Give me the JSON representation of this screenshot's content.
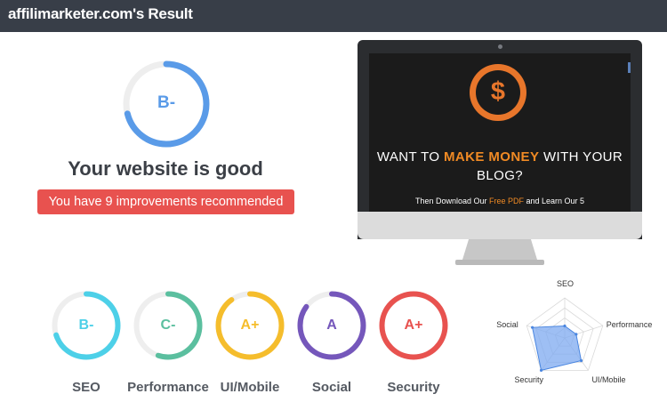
{
  "header": {
    "title": "affilimarketer.com's Result"
  },
  "summary": {
    "grade": "B-",
    "score": 0.71,
    "ring_color": "#5a9be8",
    "headline": "Your website is good",
    "improvements": "You have 9 improvements recommended",
    "improvements_color": "#e8524f"
  },
  "preview": {
    "headline_pre": "WANT TO ",
    "headline_accent": "MAKE MONEY",
    "headline_post": " WITH YOUR BLOG?",
    "sub_pre": "Then Download Our ",
    "sub_accent": "Free PDF",
    "sub_post": " and Learn Our 5",
    "logo_glyph": "$",
    "logo_icon": "dollar-coin-icon",
    "accent_color": "#f08a24"
  },
  "metrics": [
    {
      "label": "SEO",
      "grade": "B-",
      "color": "#4dd0e8",
      "score": 0.7
    },
    {
      "label": "Performance",
      "grade": "C-",
      "color": "#5bbf9f",
      "score": 0.55
    },
    {
      "label": "UI/Mobile",
      "grade": "A+",
      "color": "#f5bd2c",
      "score": 0.9
    },
    {
      "label": "Social",
      "grade": "A",
      "color": "#7557bb",
      "score": 0.85
    },
    {
      "label": "Security",
      "grade": "A+",
      "color": "#e8524f",
      "score": 1.0
    }
  ],
  "radar": {
    "axes": [
      "SEO",
      "Performance",
      "UI/Mobile",
      "Security",
      "Social"
    ],
    "values": [
      0.3,
      0.3,
      0.7,
      1.0,
      0.85
    ],
    "fill_color": "#7eaaf0",
    "stroke_color": "#4a86e0"
  }
}
